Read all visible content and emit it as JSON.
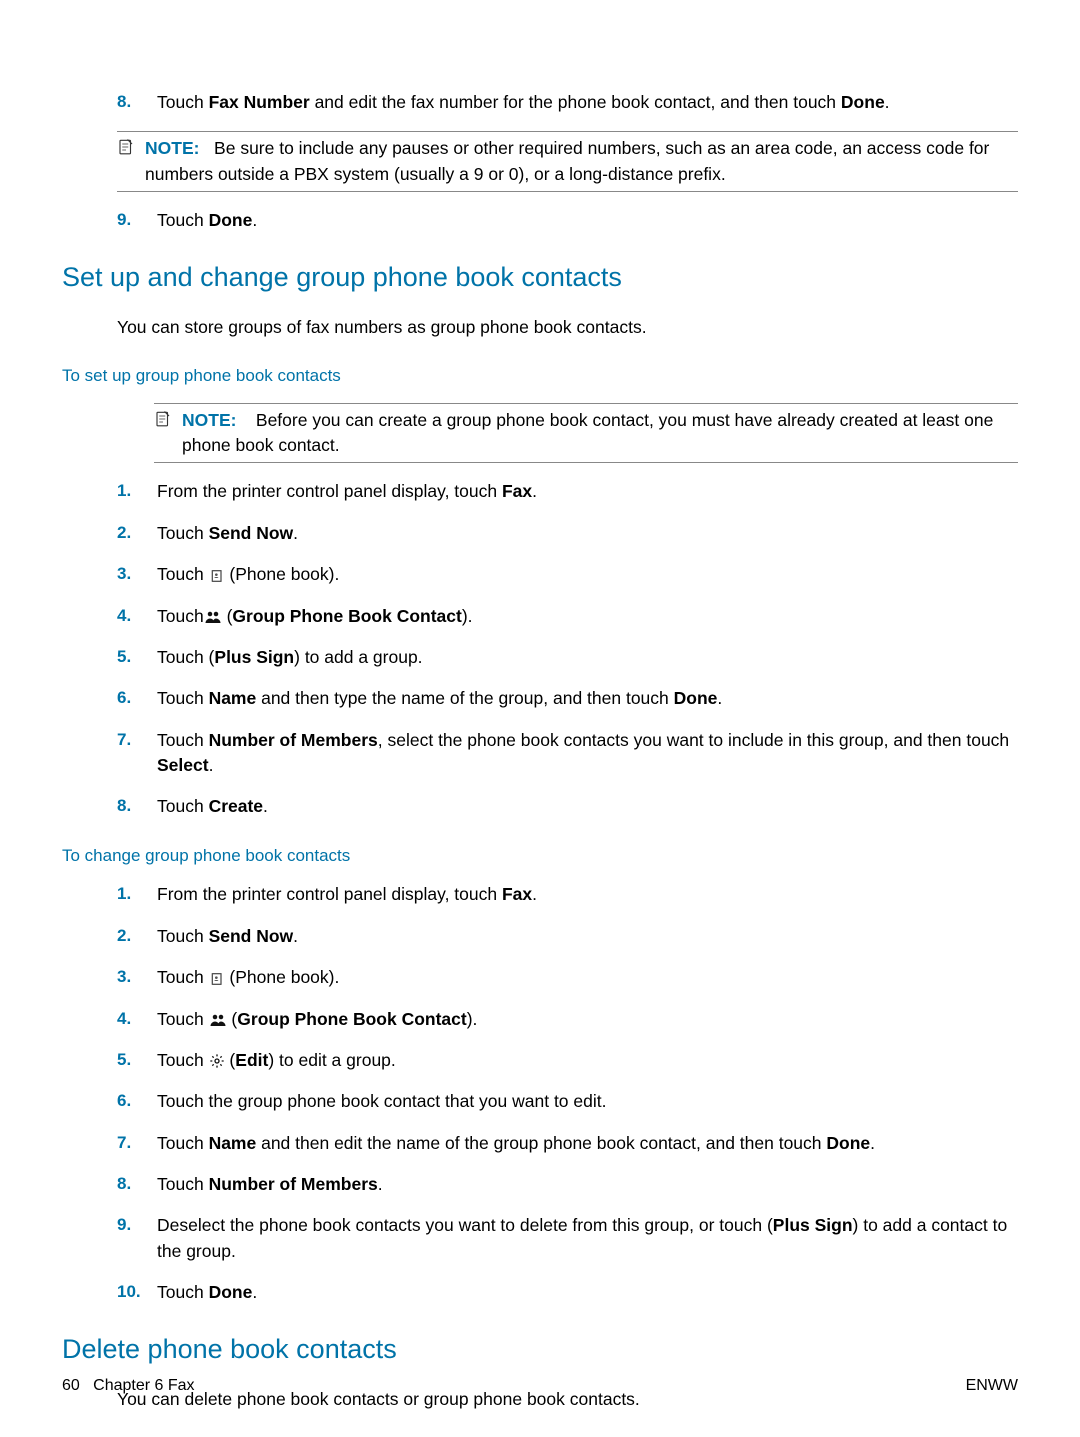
{
  "topList": {
    "items": [
      {
        "num": "8.",
        "pre": "Touch ",
        "b1": "Fax Number",
        "mid": " and edit the fax number for the phone book contact, and then touch ",
        "b2": "Done",
        "post": "."
      }
    ],
    "note": {
      "label": "NOTE:",
      "text": "Be sure to include any pauses or other required numbers, such as an area code, an access code for numbers outside a PBX system (usually a 9 or 0), or a long-distance prefix."
    },
    "after": [
      {
        "num": "9.",
        "pre": "Touch ",
        "b1": "Done",
        "post": "."
      }
    ]
  },
  "section1": {
    "heading": "Set up and change group phone book contacts",
    "intro": "You can store groups of fax numbers as group phone book contacts.",
    "sub1": {
      "heading": "To set up group phone book contacts",
      "note": {
        "label": "NOTE:",
        "text": "Before you can create a group phone book contact, you must have already created at least one phone book contact."
      },
      "items": [
        {
          "num": "1.",
          "pre": "From the printer control panel display, touch ",
          "b1": "Fax",
          "post": "."
        },
        {
          "num": "2.",
          "pre": "Touch ",
          "b1": "Send Now",
          "post": "."
        },
        {
          "num": "3.",
          "pre": "Touch ",
          "icon": "phonebook-icon",
          "post": " (Phone book)."
        },
        {
          "num": "4.",
          "pre": "Touch",
          "icon": "group-contact-icon",
          "post": " (",
          "b1": "Group Phone Book Contact",
          "post2": ")."
        },
        {
          "num": "5.",
          "pre": "Touch     (",
          "b1": "Plus Sign",
          "post2": ") to add a group."
        },
        {
          "num": "6.",
          "pre": "Touch ",
          "b1": "Name",
          "mid": " and then type the name of the group, and then touch ",
          "b2": "Done",
          "post": "."
        },
        {
          "num": "7.",
          "pre": "Touch ",
          "b1": "Number of Members",
          "mid": ", select the phone book contacts you want to include in this group, and then touch ",
          "b2": "Select",
          "post": "."
        },
        {
          "num": "8.",
          "pre": "Touch ",
          "b1": "Create",
          "post": "."
        }
      ]
    },
    "sub2": {
      "heading": "To change group phone book contacts",
      "items": [
        {
          "num": "1.",
          "pre": "From the printer control panel display, touch ",
          "b1": "Fax",
          "post": "."
        },
        {
          "num": "2.",
          "pre": "Touch ",
          "b1": "Send Now",
          "post": "."
        },
        {
          "num": "3.",
          "pre": "Touch ",
          "icon": "phonebook-icon",
          "post": " (Phone book)."
        },
        {
          "num": "4.",
          "pre": "Touch ",
          "icon": "group-contact-icon",
          "post": " (",
          "b1": "Group Phone Book Contact",
          "post2": ")."
        },
        {
          "num": "5.",
          "pre": "Touch ",
          "icon": "gear-icon",
          "post": " (",
          "b1": "Edit",
          "post2": ") to edit a group."
        },
        {
          "num": "6.",
          "pre": "Touch the group phone book contact that you want to edit."
        },
        {
          "num": "7.",
          "pre": "Touch ",
          "b1": "Name",
          "mid": " and then edit the name of the group phone book contact, and then touch ",
          "b2": "Done",
          "post": "."
        },
        {
          "num": "8.",
          "pre": "Touch ",
          "b1": "Number of Members",
          "post": "."
        },
        {
          "num": "9.",
          "pre": "Deselect the phone book contacts you want to delete from this group, or touch     (",
          "b1": "Plus Sign",
          "post2": ") to add a contact to the group."
        },
        {
          "num": "10.",
          "pre": "Touch ",
          "b1": "Done",
          "post": "."
        }
      ]
    }
  },
  "section2": {
    "heading": "Delete phone book contacts",
    "intro": "You can delete phone book contacts or group phone book contacts."
  },
  "footer": {
    "page": "60",
    "chapter": "Chapter 6   Fax",
    "right": "ENWW"
  }
}
